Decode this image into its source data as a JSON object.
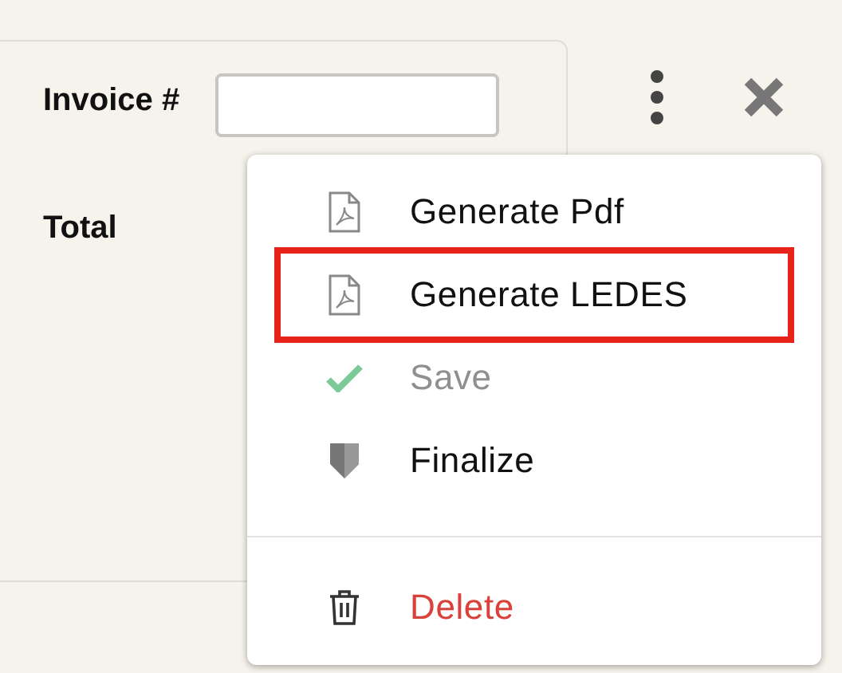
{
  "form": {
    "fields": [
      {
        "label": "Invoice #",
        "kind": "input"
      },
      {
        "label": "Total",
        "kind": "text"
      }
    ]
  },
  "menu": {
    "items": [
      {
        "label": "Generate Pdf",
        "kind": "pdf",
        "disabled": false,
        "highlighted": false
      },
      {
        "label": "Generate LEDES",
        "kind": "pdf",
        "disabled": false,
        "highlighted": true
      },
      {
        "label": "Save",
        "kind": "save",
        "disabled": true,
        "highlighted": false
      },
      {
        "label": "Finalize",
        "kind": "finalize",
        "disabled": false,
        "highlighted": false
      },
      {
        "label": "Delete",
        "kind": "delete",
        "disabled": false,
        "highlighted": false
      }
    ]
  }
}
